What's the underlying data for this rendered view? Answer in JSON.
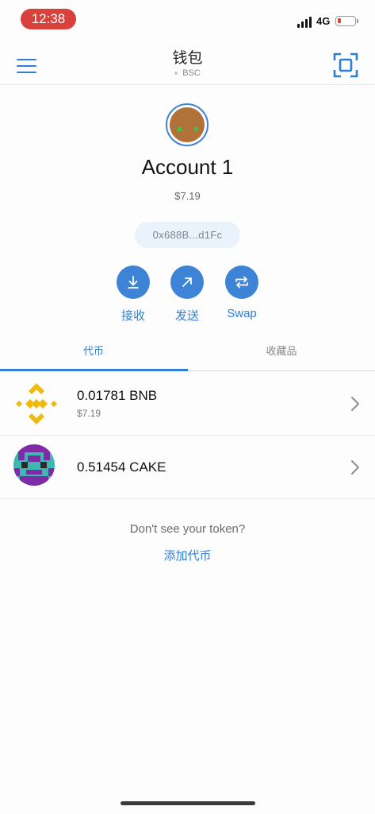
{
  "status_bar": {
    "time": "12:38",
    "network_type": "4G",
    "battery_color": "#e0443b"
  },
  "header": {
    "title": "钱包",
    "network": "BSC",
    "menu_icon": "hamburger-icon",
    "scan_icon": "qr-scan-icon"
  },
  "account": {
    "name": "Account 1",
    "balance": "$7.19",
    "address": "0x688B...d1Fc"
  },
  "actions": [
    {
      "label": "接收",
      "icon": "receive-arrow-icon"
    },
    {
      "label": "发送",
      "icon": "send-arrow-icon"
    },
    {
      "label": "Swap",
      "icon": "swap-icon"
    }
  ],
  "tabs": [
    {
      "label": "代币",
      "active": true
    },
    {
      "label": "收藏品",
      "active": false
    }
  ],
  "tokens": [
    {
      "amount": "0.01781 BNB",
      "fiat": "$7.19",
      "icon": "bnb-logo-icon"
    },
    {
      "amount": "0.51454 CAKE",
      "fiat": "",
      "icon": "cake-logo-icon"
    }
  ],
  "footer": {
    "question": "Don't see your token?",
    "add_link": "添加代币"
  },
  "colors": {
    "accent": "#3d84d6",
    "link": "#2f7fd6",
    "bnb": "#f0b90b",
    "cake_purple": "#7f2aa6",
    "cake_teal": "#3fb8b2"
  }
}
